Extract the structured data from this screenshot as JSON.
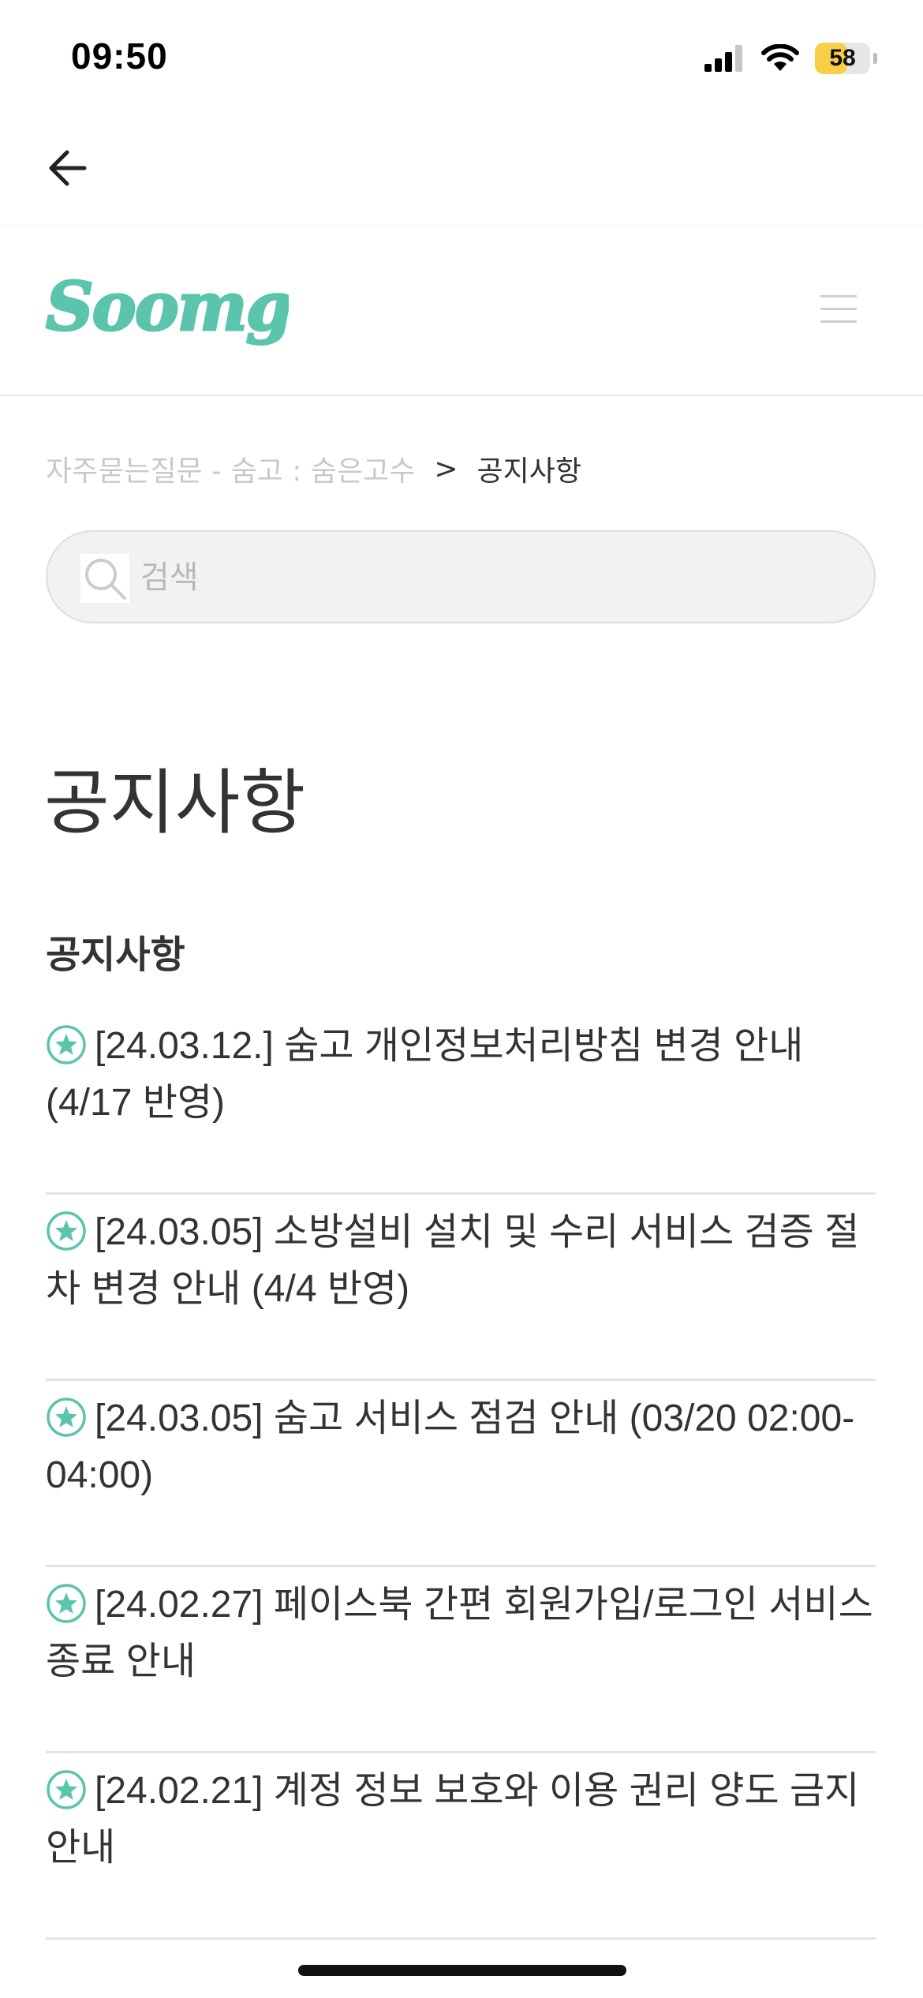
{
  "status_bar": {
    "time": "09:50",
    "battery_level": "58",
    "battery_fraction": 0.58
  },
  "nav": {
    "back_icon": "arrow-left-icon"
  },
  "header": {
    "logo_text": "Soomgo",
    "brand_color": "#5bc4ad",
    "menu_icon": "hamburger-menu-icon"
  },
  "breadcrumb": {
    "parent": "자주묻는질문 - 숨고 : 숨은고수",
    "separator": ">",
    "current": "공지사항"
  },
  "search": {
    "placeholder": "검색",
    "value": ""
  },
  "page": {
    "title": "공지사항",
    "section_title": "공지사항"
  },
  "articles": [
    {
      "title": "[24.03.12.] 숨고 개인정보처리방침 변경 안내(4/17 반영)",
      "icon": "star-icon"
    },
    {
      "title": "[24.03.05] 소방설비 설치 및 수리 서비스 검증 절차 변경 안내 (4/4 반영)",
      "icon": "star-icon"
    },
    {
      "title": "[24.03.05] 숨고 서비스 점검 안내 (03/20 02:00-04:00)",
      "icon": "star-icon"
    },
    {
      "title": "[24.02.27] 페이스북 간편 회원가입/로그인 서비스 종료 안내",
      "icon": "star-icon"
    },
    {
      "title": "[24.02.21] 계정 정보 보호와 이용 권리 양도 금지 안내",
      "icon": "star-icon"
    }
  ]
}
